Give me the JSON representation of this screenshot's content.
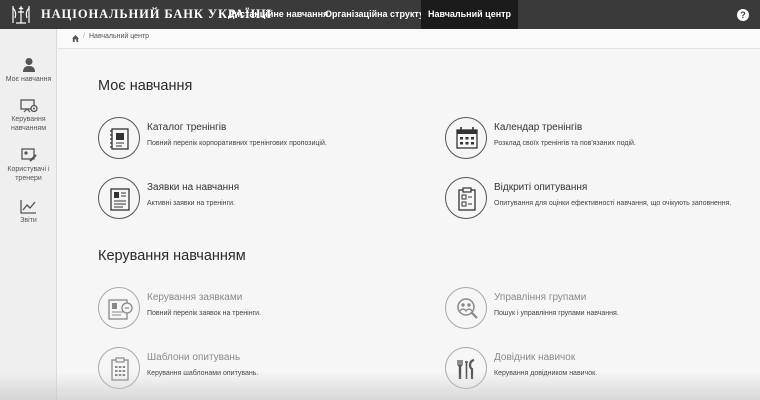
{
  "header": {
    "brand": "НАЦІОНАЛЬНИЙ БАНК УКРАЇНИ",
    "nav": [
      {
        "label": "Дистанційне навчання",
        "active": false
      },
      {
        "label": "Організаційна структура",
        "active": false
      },
      {
        "label": "Навчальний центр",
        "active": true
      }
    ],
    "help_icon": "question-icon"
  },
  "sidebar": {
    "items": [
      {
        "label_lines": [
          "Моє навчання"
        ],
        "icon": "user-icon"
      },
      {
        "label_lines": [
          "Керування",
          "навчанням"
        ],
        "icon": "board-settings-icon"
      },
      {
        "label_lines": [
          "Користувачі і",
          "тренери"
        ],
        "icon": "user-edit-icon"
      },
      {
        "label_lines": [
          "Звіти"
        ],
        "icon": "chart-icon"
      }
    ]
  },
  "breadcrumb": {
    "home_icon": "home-icon",
    "separator": "/",
    "current": "Навчальний центр"
  },
  "sections": [
    {
      "title": "Моє навчання",
      "cards": [
        {
          "title": "Каталог тренінгів",
          "desc": "Повний перелік корпоративних тренінгових пропозицій.",
          "icon": "catalog-icon"
        },
        {
          "title": "Календар тренінгів",
          "desc": "Розклад своїх тренінгів та пов'язаних подій.",
          "icon": "calendar-icon"
        },
        {
          "title": "Заявки на навчання",
          "desc": "Активні заявки на тренінги.",
          "icon": "application-icon"
        },
        {
          "title": "Відкриті опитування",
          "desc": "Опитування для оцінки ефективності навчання, що очікують заповнення.",
          "icon": "survey-icon"
        }
      ]
    },
    {
      "title": "Керування навчанням",
      "cards": [
        {
          "title": "Керування заявками",
          "desc": "Повний перелік заявок на тренінги.",
          "icon": "requests-manage-icon"
        },
        {
          "title": "Управління групами",
          "desc": "Пошук і управління групами навчання.",
          "icon": "group-search-icon"
        },
        {
          "title": "Шаблони опитувань",
          "desc": "Керування шаблонами опитувань.",
          "icon": "survey-template-icon"
        },
        {
          "title": "Довідник навичок",
          "desc": "Керування довідником навичок.",
          "icon": "tools-icon"
        }
      ]
    }
  ],
  "colors": {
    "topbar": "#3a3a3a",
    "active_tab": "#1b1b1b",
    "background": "#f6f6f6",
    "muted_text": "#8a8a8a"
  }
}
